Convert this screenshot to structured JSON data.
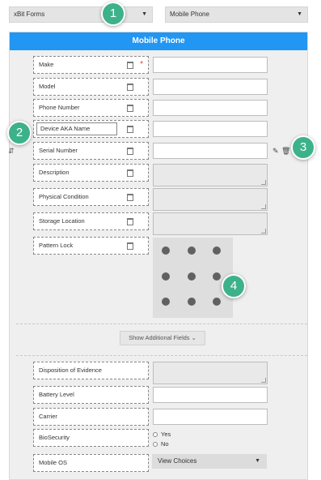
{
  "top_bar": {
    "forms_select": {
      "value": "xBit Forms"
    },
    "type_select": {
      "value": "Mobile Phone"
    }
  },
  "panel": {
    "title": "Mobile Phone",
    "rows": [
      {
        "label": "Make",
        "required_mark": "*"
      },
      {
        "label": "Model"
      },
      {
        "label": "Phone Number"
      },
      {
        "label": "Device AKA Name"
      },
      {
        "label": "Serial Number"
      },
      {
        "label": "Description"
      },
      {
        "label": "Physical Condition"
      },
      {
        "label": "Storage Location"
      },
      {
        "label": "Pattern Lock"
      }
    ],
    "show_more_label": "Show Additional Fields ⌄",
    "additional_rows": [
      {
        "label": "Disposition of Evidence"
      },
      {
        "label": "Battery Level"
      },
      {
        "label": "Carrier"
      },
      {
        "label": "BioSecurity"
      },
      {
        "label": "Mobile OS"
      }
    ],
    "biosecurity_options": [
      "Yes",
      "No"
    ],
    "mobile_os_select": {
      "value": "View Choices"
    }
  },
  "callouts": [
    "1",
    "2",
    "3",
    "4"
  ],
  "icons": {
    "dropdown": "chevron-down-icon",
    "field_tag": "tag-icon",
    "move": "drag-handle-icon",
    "edit": "pencil-icon",
    "delete": "trash-icon"
  },
  "colors": {
    "header": "#2196f3",
    "callout": "#3db28a",
    "required": "#e53935"
  }
}
